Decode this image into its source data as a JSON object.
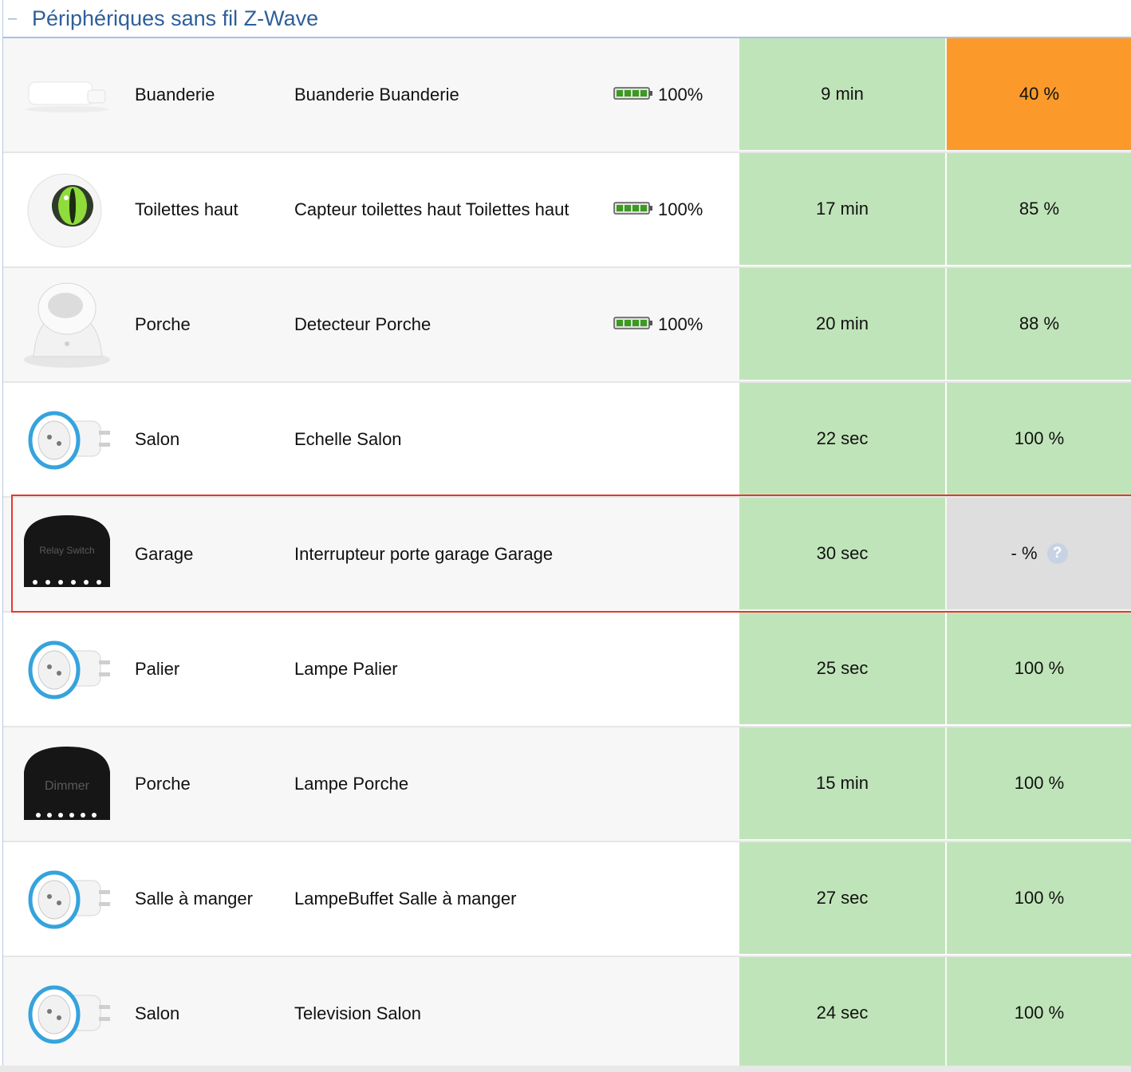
{
  "header": {
    "title": "Périphériques sans fil Z-Wave",
    "toggle": "–"
  },
  "rows": [
    {
      "device_icon": "door-window-sensor-icon",
      "room": "Buanderie",
      "description": "Buanderie Buanderie",
      "battery": "100%",
      "last_seen": "9 min",
      "signal": "40 %",
      "signal_status": "warning"
    },
    {
      "device_icon": "flood-sensor-icon",
      "room": "Toilettes haut",
      "description": "Capteur toilettes haut Toilettes haut",
      "battery": "100%",
      "last_seen": "17 min",
      "signal": "85 %",
      "signal_status": "ok"
    },
    {
      "device_icon": "motion-sensor-icon",
      "room": "Porche",
      "description": "Detecteur Porche",
      "battery": "100%",
      "last_seen": "20 min",
      "signal": "88 %",
      "signal_status": "ok"
    },
    {
      "device_icon": "wall-plug-icon",
      "room": "Salon",
      "description": "Echelle Salon",
      "battery": null,
      "last_seen": "22 sec",
      "signal": "100 %",
      "signal_status": "ok"
    },
    {
      "device_icon": "relay-switch-icon",
      "icon_label": "Relay Switch",
      "room": "Garage",
      "description": "Interrupteur porte garage Garage",
      "battery": null,
      "last_seen": "30 sec",
      "signal": "- %",
      "signal_status": "unknown",
      "help": "?"
    },
    {
      "device_icon": "wall-plug-icon",
      "room": "Palier",
      "description": "Lampe Palier",
      "battery": null,
      "last_seen": "25 sec",
      "signal": "100 %",
      "signal_status": "ok"
    },
    {
      "device_icon": "dimmer-icon",
      "icon_label": "Dimmer",
      "room": "Porche",
      "description": "Lampe Porche",
      "battery": null,
      "last_seen": "15 min",
      "signal": "100 %",
      "signal_status": "ok"
    },
    {
      "device_icon": "wall-plug-icon",
      "room": "Salle à manger",
      "description": "LampeBuffet Salle à manger",
      "battery": null,
      "last_seen": "27 sec",
      "signal": "100 %",
      "signal_status": "ok"
    },
    {
      "device_icon": "wall-plug-icon",
      "room": "Salon",
      "description": "Television Salon",
      "battery": null,
      "last_seen": "24 sec",
      "signal": "100 %",
      "signal_status": "ok"
    }
  ],
  "colors": {
    "ok": "#c0e4b9",
    "warning": "#fb9a2a",
    "unknown": "#dedede",
    "highlight": "#e23a2e",
    "title": "#2e5f9a"
  }
}
